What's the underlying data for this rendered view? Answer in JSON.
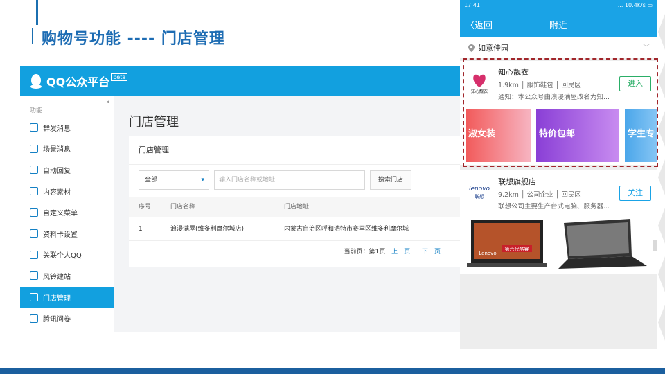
{
  "slide": {
    "title": "购物号功能 ----  门店管理"
  },
  "qq": {
    "brand": "QQ公众平台",
    "beta": "beta",
    "sidebar": {
      "group": "功能",
      "items": [
        {
          "label": "群发消息",
          "icon": "broadcast-icon"
        },
        {
          "label": "场景消息",
          "icon": "scene-message-icon"
        },
        {
          "label": "自动回复",
          "icon": "auto-reply-icon"
        },
        {
          "label": "内容素材",
          "icon": "content-icon"
        },
        {
          "label": "自定义菜单",
          "icon": "menu-icon"
        },
        {
          "label": "资料卡设置",
          "icon": "profile-card-icon"
        },
        {
          "label": "关联个人QQ",
          "icon": "link-icon"
        },
        {
          "label": "风铃建站",
          "icon": "site-builder-icon"
        },
        {
          "label": "门店管理",
          "icon": "store-icon",
          "active": true
        },
        {
          "label": "腾讯问卷",
          "icon": "survey-icon"
        }
      ]
    },
    "main": {
      "page_title": "门店管理",
      "card_title": "门店管理",
      "filter_selected": "全部",
      "search_placeholder": "输入门店名称或地址",
      "search_button": "搜索门店",
      "columns": [
        "序号",
        "门店名称",
        "门店地址"
      ],
      "rows": [
        [
          "1",
          "浪漫满屋(维多利摩尔城店)",
          "内蒙古自治区呼和浩特市赛罕区维多利摩尔城"
        ]
      ],
      "pager": {
        "current": "当前页：第1页",
        "prev": "上一页",
        "next": "下一页"
      }
    }
  },
  "phone": {
    "status": {
      "time": "17:41",
      "speed": "... 10.4K/s"
    },
    "nav": {
      "back": "返回",
      "title": "附近"
    },
    "location": "如意佳园",
    "shops": [
      {
        "name": "知心靓衣",
        "meta": "1.9km │ 服饰鞋包 │ 回民区",
        "note": "通知：本公众号由浪漫满屋改名为知...",
        "button": "进入",
        "logo_text": "知心靓衣",
        "banners": [
          "淑女装",
          "特价包邮",
          "学生专"
        ]
      },
      {
        "name": "联想旗舰店",
        "meta": "9.2km │ 公司企业 │ 回民区",
        "note": "联想公司主要生产台式电脑、服务器...",
        "button": "关注",
        "logo_text": "lenovo",
        "logo_sub": "联想",
        "laptop_badge": "第六代酷睿",
        "laptop_brand": "Lenovo"
      }
    ]
  },
  "colors": {
    "accent": "#12a0df",
    "title": "#1d6cb3",
    "highlight": "#a1262b",
    "enter_green": "#2aae67"
  }
}
